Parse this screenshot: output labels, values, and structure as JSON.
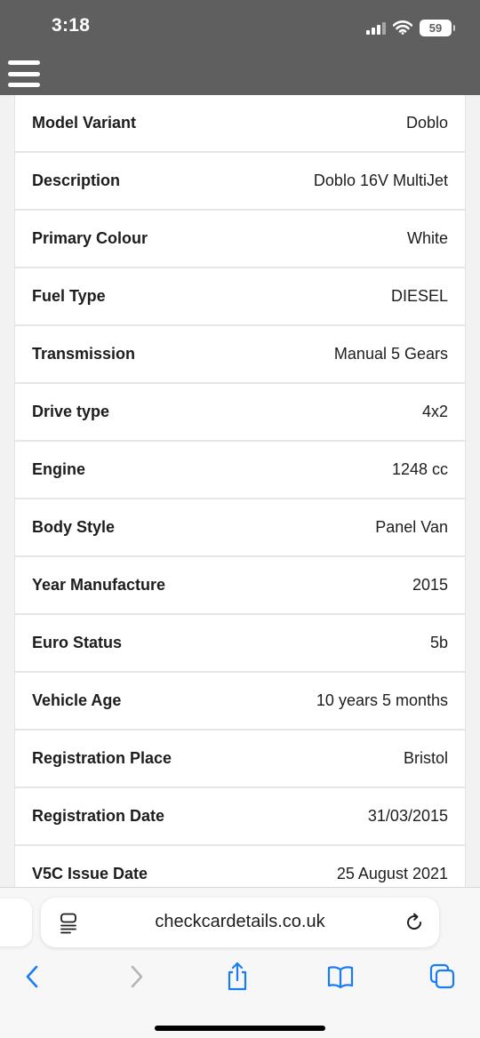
{
  "status_bar": {
    "time": "3:18",
    "battery": "59",
    "icons": [
      "signal-icon",
      "wifi-icon",
      "battery-icon"
    ]
  },
  "header": {
    "menu_icon": "hamburger-menu-icon",
    "background_color": "#5f5f5f"
  },
  "vehicle_details": [
    {
      "label": "Model Variant",
      "value": "Doblo"
    },
    {
      "label": "Description",
      "value": "Doblo 16V MultiJet"
    },
    {
      "label": "Primary Colour",
      "value": "White"
    },
    {
      "label": "Fuel Type",
      "value": "DIESEL"
    },
    {
      "label": "Transmission",
      "value": "Manual 5 Gears"
    },
    {
      "label": "Drive type",
      "value": "4x2"
    },
    {
      "label": "Engine",
      "value": "1248 cc"
    },
    {
      "label": "Body Style",
      "value": "Panel Van"
    },
    {
      "label": "Year Manufacture",
      "value": "2015"
    },
    {
      "label": "Euro Status",
      "value": "5b"
    },
    {
      "label": "Vehicle Age",
      "value": "10 years 5 months"
    },
    {
      "label": "Registration Place",
      "value": "Bristol"
    },
    {
      "label": "Registration Date",
      "value": "31/03/2015"
    },
    {
      "label": "V5C Issue Date",
      "value": "25 August 2021"
    }
  ],
  "browser": {
    "url": "checkcardetails.co.uk",
    "accent_color": "#1a7cf5",
    "icons": [
      "page-menu-icon",
      "reload-icon",
      "back-icon",
      "forward-icon",
      "share-icon",
      "bookmarks-icon",
      "tabs-icon"
    ]
  }
}
